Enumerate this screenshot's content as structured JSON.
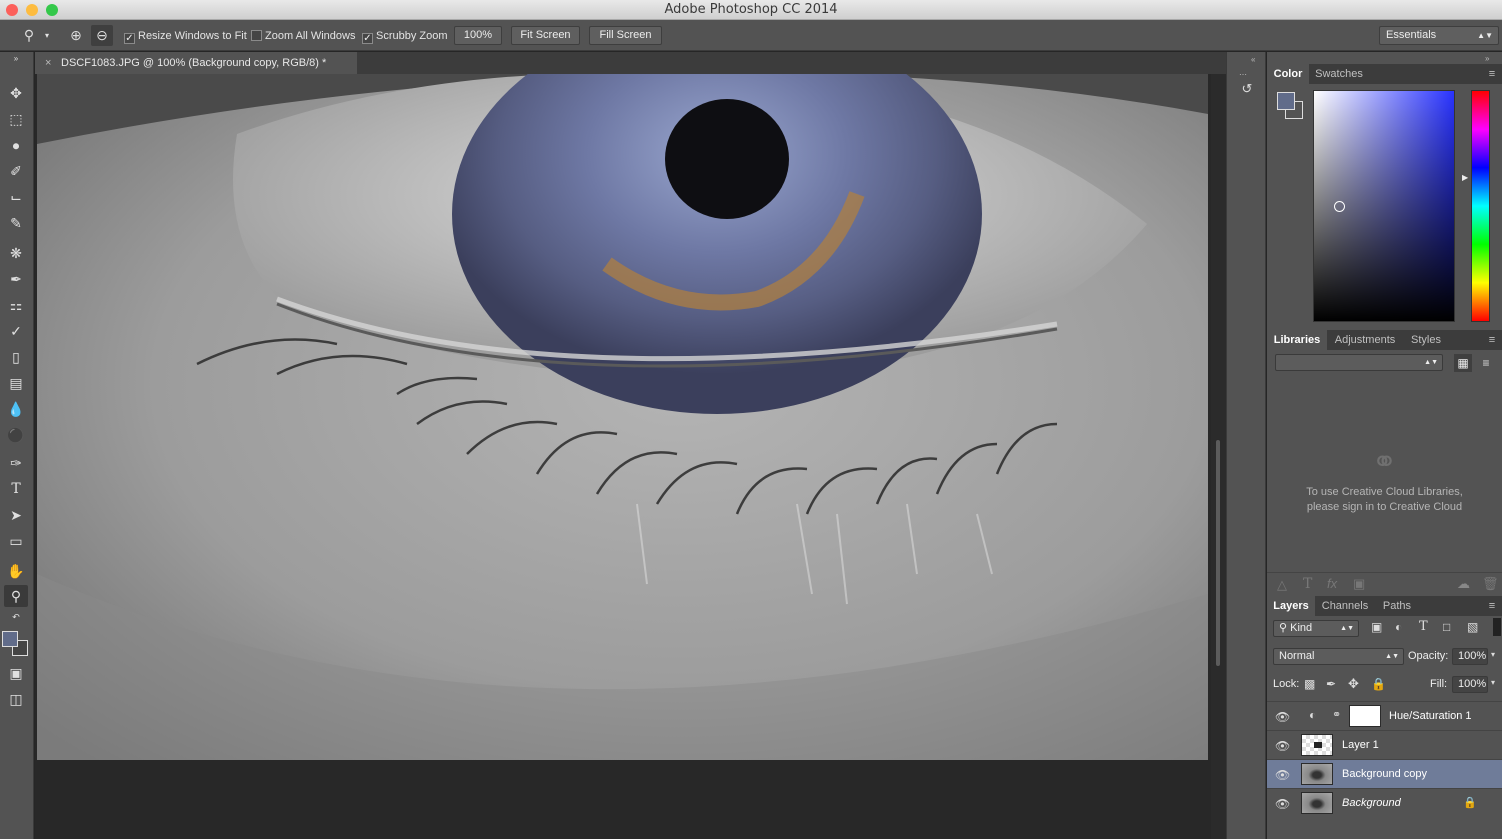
{
  "window": {
    "title": "Adobe Photoshop CC 2014"
  },
  "options": {
    "resize_windows": "Resize Windows to Fit",
    "zoom_all": "Zoom All Windows",
    "scrubby_zoom": "Scrubby Zoom",
    "zoom_value": "100%",
    "fit_screen": "Fit Screen",
    "fill_screen": "Fill Screen",
    "workspace": "Essentials",
    "resize_checked": true,
    "zoom_all_checked": false,
    "scrubby_checked": true
  },
  "document": {
    "tab_label": "DSCF1083.JPG @ 100% (Background copy, RGB/8) *"
  },
  "color_panel": {
    "tabs": [
      "Color",
      "Swatches"
    ]
  },
  "libraries_panel": {
    "tabs": [
      "Libraries",
      "Adjustments",
      "Styles"
    ],
    "message_line1": "To use Creative Cloud Libraries,",
    "message_line2": "please sign in to Creative Cloud"
  },
  "layers_panel": {
    "tabs": [
      "Layers",
      "Channels",
      "Paths"
    ],
    "filter": "Kind",
    "blend_mode": "Normal",
    "opacity_label": "Opacity:",
    "opacity": "100%",
    "lock_label": "Lock:",
    "fill_label": "Fill:",
    "fill": "100%",
    "layers": [
      {
        "name": "Hue/Saturation 1",
        "selected": false
      },
      {
        "name": "Layer 1",
        "selected": false
      },
      {
        "name": "Background copy",
        "selected": true
      },
      {
        "name": "Background",
        "selected": false
      }
    ]
  },
  "colors": {
    "selected_layer": "#6f7c99",
    "foreground": "#616c8a",
    "accent": "#4a6fa5"
  }
}
